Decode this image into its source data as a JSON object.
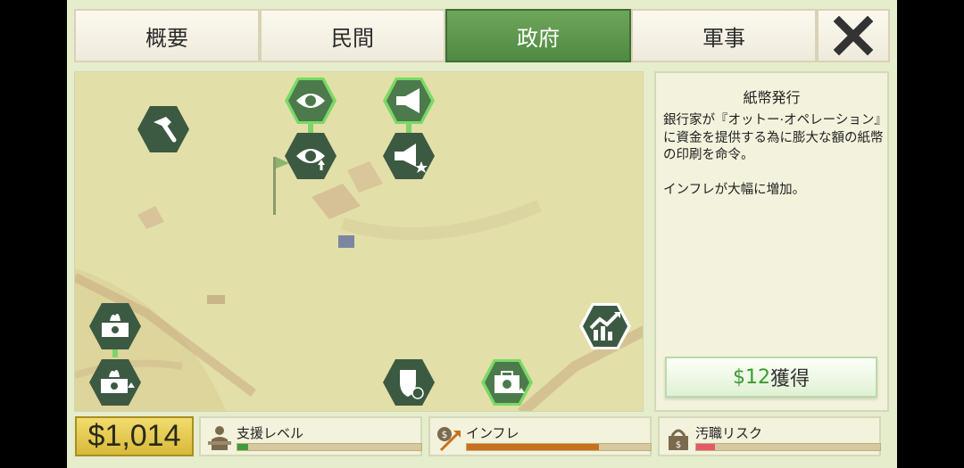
{
  "tabs": [
    {
      "label": "概要",
      "active": false
    },
    {
      "label": "民間",
      "active": false
    },
    {
      "label": "政府",
      "active": true
    },
    {
      "label": "軍事",
      "active": false
    }
  ],
  "close_symbol": "✕",
  "panel": {
    "title": "紙幣発行",
    "description": "銀行家が『オットー·オペレーション』に資金を提供する為に膨大な額の紙幣の印刷を命令。",
    "effect": "インフレが大幅に増加。",
    "buy_amount": "$12",
    "buy_suffix": "獲得"
  },
  "money": "$1,014",
  "stats": [
    {
      "label": "支援レベル",
      "icon": "support-icon",
      "level": 0.06,
      "color": "#3f9b3a"
    },
    {
      "label": "インフレ",
      "icon": "inflation-icon",
      "level": 0.72,
      "color": "#c9701c"
    },
    {
      "label": "汚職リスク",
      "icon": "corruption-icon",
      "level": 0.1,
      "color": "#e35a6a"
    }
  ],
  "nodes": [
    {
      "name": "build-hammer-node",
      "icon": "hammer-icon",
      "state": "available"
    },
    {
      "name": "surveillance-node",
      "icon": "eye-icon",
      "state": "unlocked"
    },
    {
      "name": "surveillance-upgrade-node",
      "icon": "eye-upgrade-icon",
      "state": "available"
    },
    {
      "name": "propaganda-node",
      "icon": "megaphone-icon",
      "state": "unlocked"
    },
    {
      "name": "propaganda-upgrade-node",
      "icon": "megaphone-star-icon",
      "state": "available"
    },
    {
      "name": "print-money-node",
      "icon": "money-fire-icon",
      "state": "available"
    },
    {
      "name": "print-money-upgrade-node",
      "icon": "money-fire-upgrade-icon",
      "state": "available"
    },
    {
      "name": "protect-funds-node",
      "icon": "shield-money-icon",
      "state": "available"
    },
    {
      "name": "bank-investment-node",
      "icon": "briefcase-money-icon",
      "state": "unlocked"
    },
    {
      "name": "growth-chart-node",
      "icon": "growth-chart-icon",
      "state": "selected"
    }
  ]
}
